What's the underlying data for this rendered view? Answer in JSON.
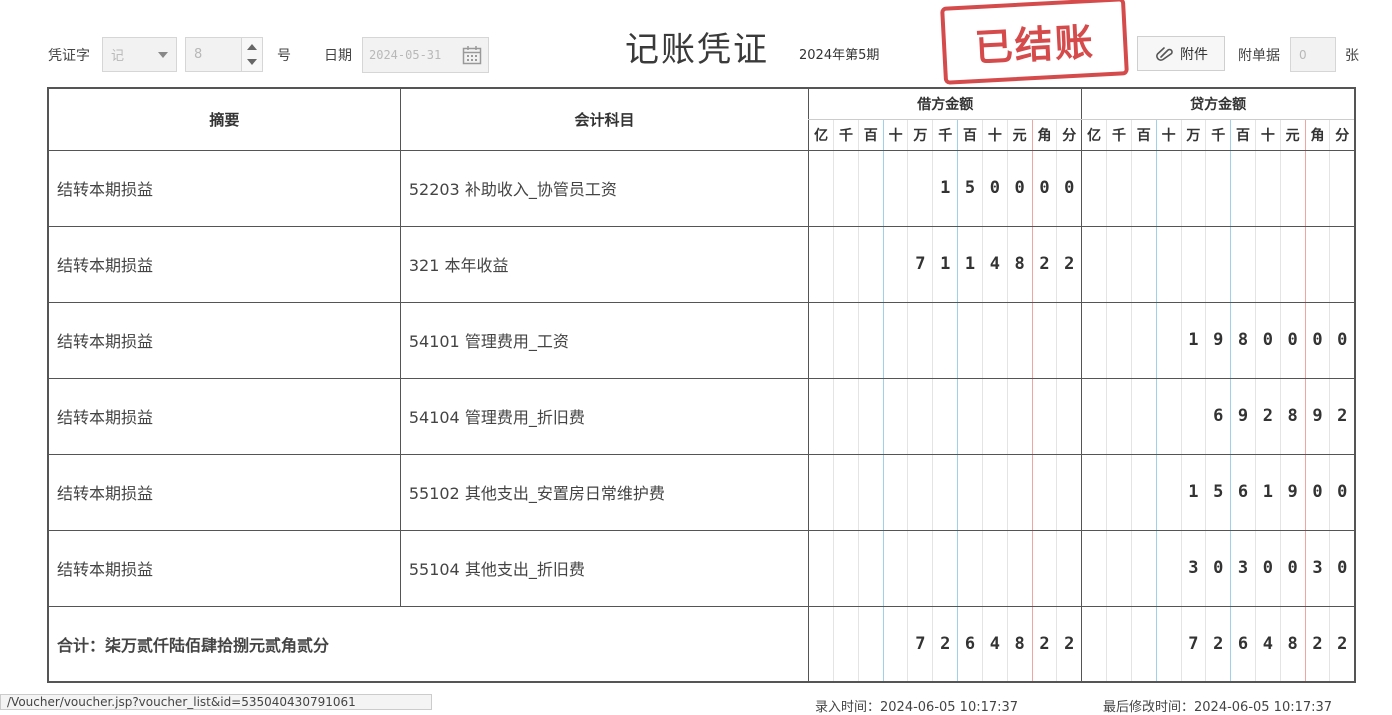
{
  "header": {
    "voucher_word_label": "凭证字",
    "voucher_word_value": "记",
    "voucher_no_value": "8",
    "voucher_no_suffix": "号",
    "date_label": "日期",
    "date_value": "2024-05-31",
    "title": "记账凭证",
    "period": "2024年第5期",
    "stamp": "已结账",
    "attach_button": "附件",
    "attach_docs_label": "附单据",
    "attach_docs_value": "0",
    "attach_docs_unit": "张"
  },
  "table": {
    "col_summary": "摘要",
    "col_account": "会计科目",
    "col_debit": "借方金额",
    "col_credit": "贷方金额",
    "units": [
      "亿",
      "千",
      "百",
      "十",
      "万",
      "千",
      "百",
      "十",
      "元",
      "角",
      "分"
    ],
    "rows": [
      {
        "summary": "结转本期损益",
        "account": "52203  补助收入_协管员工资",
        "debit": "150000",
        "credit": ""
      },
      {
        "summary": "结转本期损益",
        "account": "321  本年收益",
        "debit": "7114822",
        "credit": ""
      },
      {
        "summary": "结转本期损益",
        "account": "54101  管理费用_工资",
        "debit": "",
        "credit": "1980000"
      },
      {
        "summary": "结转本期损益",
        "account": "54104  管理费用_折旧费",
        "debit": "",
        "credit": "692892"
      },
      {
        "summary": "结转本期损益",
        "account": "55102  其他支出_安置房日常维护费",
        "debit": "",
        "credit": "1561900"
      },
      {
        "summary": "结转本期损益",
        "account": "55104  其他支出_折旧费",
        "debit": "",
        "credit": "3030030"
      }
    ],
    "total_label": "合计：柒万贰仟陆佰肆拾捌元贰角贰分",
    "total_debit": "7264822",
    "total_credit": "7264822"
  },
  "footer": {
    "url_text": "/Voucher/voucher.jsp?voucher_list&id=535040430791061",
    "entry_time": "录入时间：2024-06-05 10:17:37",
    "modified_time": "最后修改时间：2024-06-05 10:17:37"
  }
}
